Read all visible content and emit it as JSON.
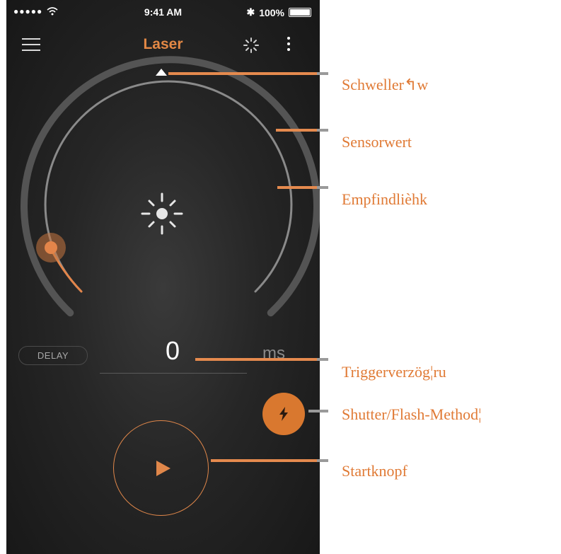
{
  "status_bar": {
    "signal": "●●●●●",
    "time": "9:41 AM",
    "bluetooth": "✱",
    "battery": "100%"
  },
  "app": {
    "title": "Laser"
  },
  "icons": {
    "menu": "hamburger-icon",
    "activity": "spinner-icon",
    "more": "more-vertical-icon",
    "sensor": "sun-icon",
    "flash": "lightning-bolt-icon",
    "start": "play-icon"
  },
  "delay": {
    "label": "DELAY",
    "value": "0",
    "unit": "ms"
  },
  "callouts": [
    {
      "label": "Schweller↰w"
    },
    {
      "label": "Sensorwert"
    },
    {
      "label": "Empfindlièhk"
    },
    {
      "label": "Triggerverzög¦ru"
    },
    {
      "label": "Shutter/Flash-Method¦"
    },
    {
      "label": "Startknopf"
    }
  ],
  "colors": {
    "accent": "#e38845",
    "callout_text": "#e07a35",
    "background": "#1c1c1c"
  }
}
